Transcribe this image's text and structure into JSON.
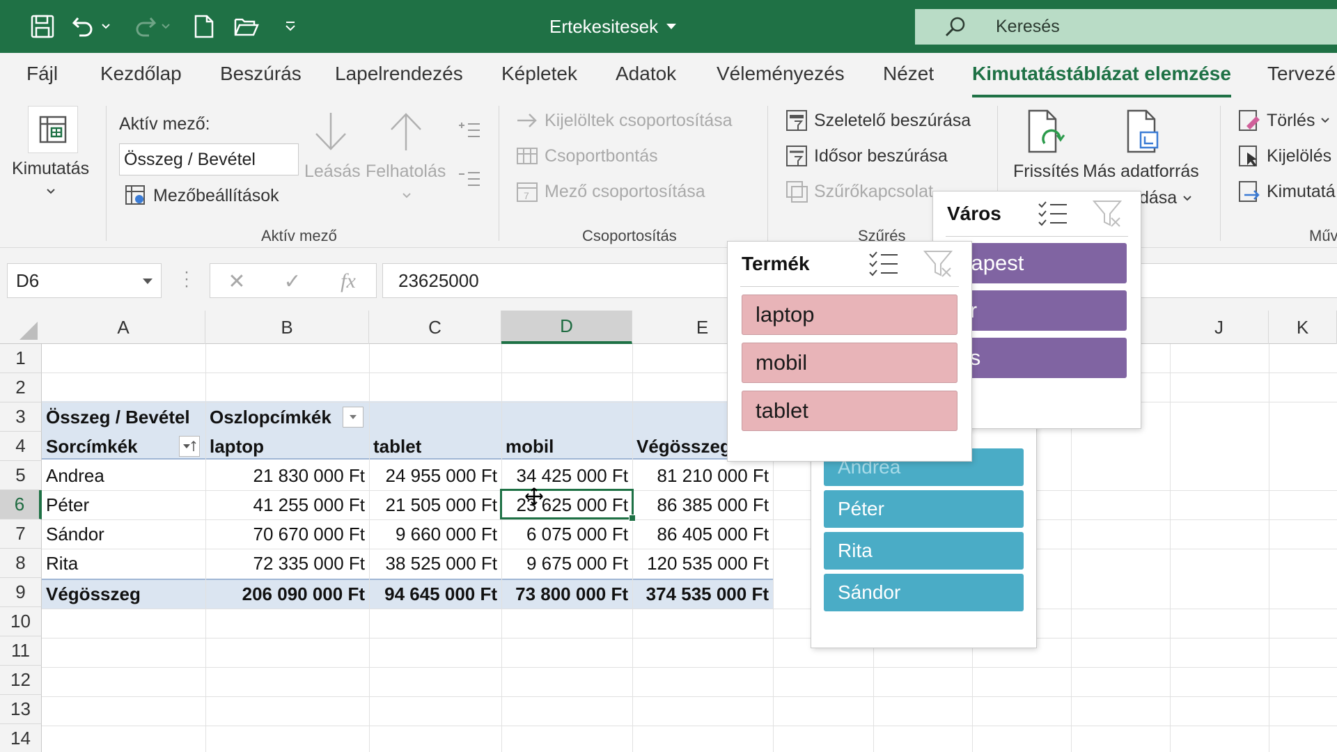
{
  "titlebar": {
    "document_title": "Ertekesitesek",
    "search_placeholder": "Keresés",
    "colors": {
      "bar": "#1f7145",
      "search_bg": "#b9dcc6"
    },
    "qat_icons": [
      "save-icon",
      "undo-icon",
      "redo-icon",
      "new-file-icon",
      "open-folder-icon",
      "customize-qat-icon"
    ]
  },
  "tabs": [
    {
      "label": "Fájl"
    },
    {
      "label": "Kezdőlap"
    },
    {
      "label": "Beszúrás"
    },
    {
      "label": "Lapelrendezés"
    },
    {
      "label": "Képletek"
    },
    {
      "label": "Adatok"
    },
    {
      "label": "Véleményezés"
    },
    {
      "label": "Nézet"
    },
    {
      "label": "Kimutatástáblázat elemzése",
      "active": true
    },
    {
      "label": "Tervezé"
    }
  ],
  "ribbon": {
    "pivot_label": "Kimutatás",
    "active_field": {
      "label": "Aktív mező:",
      "value": "Összeg / Bevétel",
      "field_settings": "Mezőbeállítások",
      "drill_down": "Leásás",
      "drill_up": "Felhatolás",
      "group_label": "Aktív mező"
    },
    "grouping": {
      "group_selection": "Kijelöltek csoportosítása",
      "ungroup": "Csoportbontás",
      "group_field": "Mező csoportosítása",
      "group_label": "Csoportosítás"
    },
    "filter": {
      "insert_slicer": "Szeletelő beszúrása",
      "insert_timeline": "Idősor beszúrása",
      "filter_connections": "Szűrőkapcsolat",
      "group_label": "Szűrés"
    },
    "data": {
      "refresh": "Frissítés",
      "change_source_line1": "Más adatforrás",
      "change_source_line2": "dása"
    },
    "actions": {
      "clear": "Törlés",
      "select": "Kijelölés",
      "move": "Kimutatá",
      "group_label": "Műv"
    }
  },
  "formula_bar": {
    "name_box": "D6",
    "cancel_icon": "✕",
    "enter_icon": "✓",
    "fx_label": "fx",
    "value": "23625000"
  },
  "grid": {
    "columns": [
      "A",
      "B",
      "C",
      "D",
      "E",
      "J",
      "K"
    ],
    "selected_column": "D",
    "rows": [
      "1",
      "2",
      "3",
      "4",
      "5",
      "6",
      "7",
      "8",
      "9",
      "10",
      "11",
      "12",
      "13",
      "14"
    ],
    "selected_row": "6"
  },
  "pivot": {
    "value_header": "Összeg / Bevétel",
    "column_labels": "Oszlopcímkék",
    "row_labels": "Sorcímkék",
    "headers": [
      "laptop",
      "tablet",
      "mobil",
      "Végösszeg"
    ],
    "rows": [
      {
        "name": "Andrea",
        "values": [
          "21 830 000 Ft",
          "24 955 000 Ft",
          "34 425 000 Ft",
          "81 210 000 Ft"
        ]
      },
      {
        "name": "Péter",
        "values": [
          "41 255 000 Ft",
          "21 505 000 Ft",
          "23 625 000 Ft",
          "86 385 000 Ft"
        ]
      },
      {
        "name": "Sándor",
        "values": [
          "70 670 000 Ft",
          "9 660 000 Ft",
          "6 075 000 Ft",
          "86 405 000 Ft"
        ]
      },
      {
        "name": "Rita",
        "values": [
          "72 335 000 Ft",
          "38 525 000 Ft",
          "9 675 000 Ft",
          "120 535 000 Ft"
        ]
      }
    ],
    "total": {
      "name": "Végösszeg",
      "values": [
        "206 090 000 Ft",
        "94 645 000 Ft",
        "73 800 000 Ft",
        "374 535 000 Ft"
      ]
    }
  },
  "slicers": {
    "termek": {
      "title": "Termék",
      "items": [
        "laptop",
        "mobil",
        "tablet"
      ],
      "color": "#e8b4b8"
    },
    "varos": {
      "title": "Város",
      "items": [
        "Budapest",
        "Győr",
        "Pécs"
      ],
      "visible_text": [
        "udapest",
        "yőr",
        "écs"
      ],
      "color": "#8064a2"
    },
    "nev": {
      "items": [
        "Andrea",
        "Péter",
        "Rita",
        "Sándor"
      ],
      "color": "#4aacc6"
    }
  }
}
